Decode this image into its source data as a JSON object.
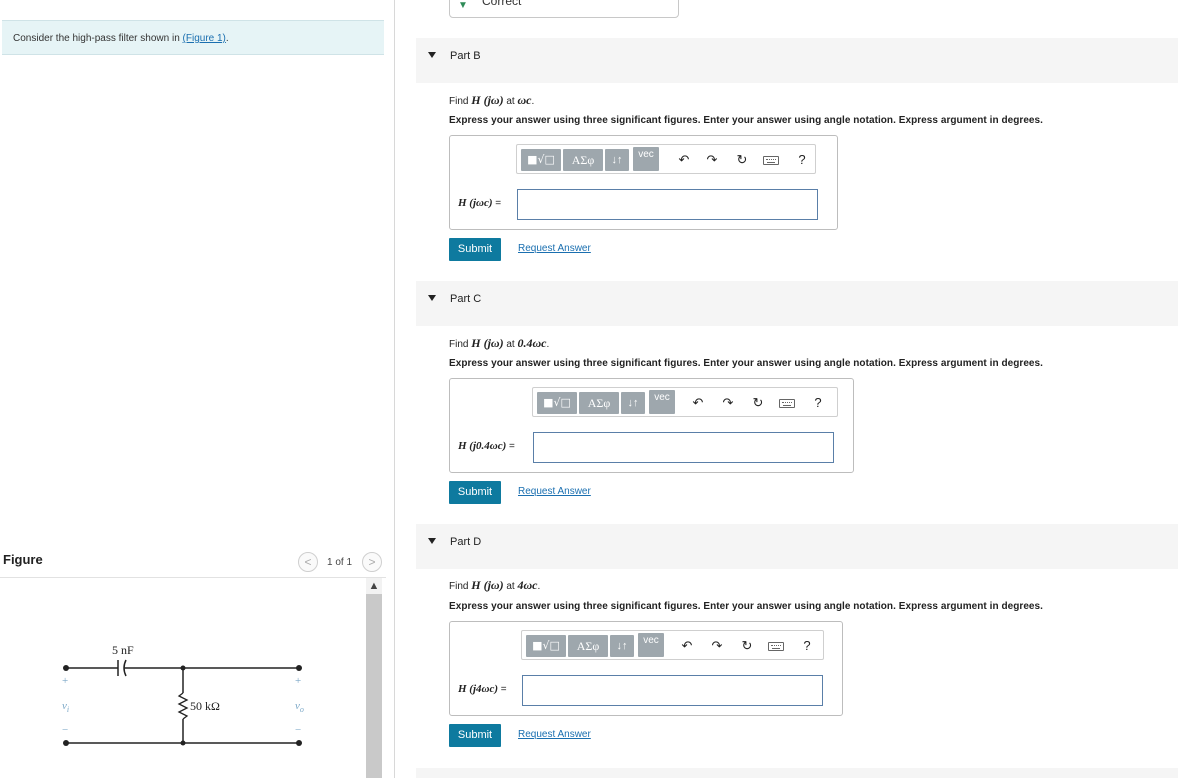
{
  "intro": {
    "text": "Consider the high-pass filter shown in",
    "figure_link": "(Figure 1)",
    "suffix": "."
  },
  "figure_panel": {
    "title": "Figure",
    "prev": "<",
    "next": ">",
    "count": "1 of 1",
    "scroll_up": "^"
  },
  "circuit": {
    "capacitor": "5 nF",
    "resistor": "50 kΩ",
    "vin": "v",
    "vin_sub": "i",
    "vout": "v",
    "vout_sub": "o",
    "plus": "+",
    "minus": "−"
  },
  "previous_part": {
    "status": "Correct",
    "status_color": "#2e8b57"
  },
  "toolbar": {
    "sqrt": "■√□",
    "greek": "ΑΣφ",
    "arrows": "↓↑",
    "vec": "vec",
    "undo_icon": "undo-icon",
    "redo_icon": "redo-icon",
    "reset_icon": "reset-icon",
    "keyboard_icon": "keyboard-icon",
    "help": "?"
  },
  "parts": [
    {
      "label": "Part B",
      "find_prefix": "Find",
      "find_math": "H (jω)",
      "find_at": "at",
      "find_point": "ωc",
      "find_suffix": ".",
      "instructions": "Express your answer using three significant figures. Enter your answer using angle notation. Express argument in degrees.",
      "answer_label": "H (jωc)",
      "input_value": "",
      "submit": "Submit",
      "request": "Request Answer"
    },
    {
      "label": "Part C",
      "find_prefix": "Find",
      "find_math": "H (jω)",
      "find_at": "at",
      "find_point": "0.4ωc",
      "find_suffix": ".",
      "instructions": "Express your answer using three significant figures. Enter your answer using angle notation. Express argument in degrees.",
      "answer_label": "H (j0.4ωc)",
      "input_value": "",
      "submit": "Submit",
      "request": "Request Answer"
    },
    {
      "label": "Part D",
      "find_prefix": "Find",
      "find_math": "H (jω)",
      "find_at": "at",
      "find_point": "4ωc",
      "find_suffix": ".",
      "instructions": "Express your answer using three significant figures. Enter your answer using angle notation. Express argument in degrees.",
      "answer_label": "H (j4ωc)",
      "input_value": "",
      "submit": "Submit",
      "request": "Request Answer"
    }
  ],
  "equals": "=",
  "colors": {
    "submit": "#0e7a9f",
    "link": "#1a6fb0",
    "intro_bg": "#e6f4f6",
    "toolbar_btn": "#9ea7ad"
  }
}
